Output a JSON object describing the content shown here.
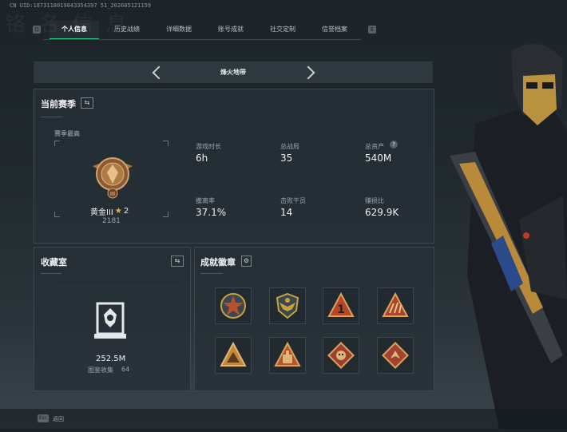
{
  "header": {
    "uid": "CN UID:1873118019843354397 51_202605121159",
    "watermark": "铬 名 信 息"
  },
  "tabs": {
    "left_key": "Q",
    "right_key": "E",
    "items": [
      {
        "label": "个人信息",
        "active": true
      },
      {
        "label": "历史战绩",
        "active": false
      },
      {
        "label": "详细数据",
        "active": false
      },
      {
        "label": "账号成就",
        "active": false
      },
      {
        "label": "社交定制",
        "active": false
      },
      {
        "label": "信誉档案",
        "active": false
      }
    ]
  },
  "map_banner": {
    "title": "烽火地带"
  },
  "season": {
    "title": "当前赛季",
    "toggle_icon": "swap-icon",
    "best_label": "赛季最高",
    "rank_name": "黄金III",
    "rank_stars": "2",
    "rank_score": "2181",
    "stats": [
      {
        "label": "游戏时长",
        "value": "6h"
      },
      {
        "label": "总战局",
        "value": "35"
      },
      {
        "label": "总资产",
        "value": "540M",
        "help": "?"
      },
      {
        "label": "撤离率",
        "value": "37.1%"
      },
      {
        "label": "击败干员",
        "value": "14"
      },
      {
        "label": "赚损比",
        "value": "629.9K"
      }
    ]
  },
  "collection": {
    "title": "收藏室",
    "value": "252.5M",
    "count_label": "图鉴收集",
    "count_value": "64"
  },
  "badges": {
    "title": "成就徽章",
    "items": [
      {
        "name": "star-cross-badge",
        "color": "#b5532f"
      },
      {
        "name": "eagle-shield-badge",
        "color": "#c9a23a"
      },
      {
        "name": "number-one-badge",
        "color": "#b8452a"
      },
      {
        "name": "claw-badge",
        "color": "#a8462a"
      },
      {
        "name": "mountain-triangle-badge",
        "color": "#c28a35"
      },
      {
        "name": "building-badge",
        "color": "#b5532f"
      },
      {
        "name": "beast-badge-1",
        "color": "#9e3e2e"
      },
      {
        "name": "beast-badge-2",
        "color": "#a24232"
      }
    ]
  },
  "footer": {
    "key": "Esc",
    "label": "返回"
  },
  "colors": {
    "accent": "#2fc98a",
    "gold": "#c99a4a"
  }
}
